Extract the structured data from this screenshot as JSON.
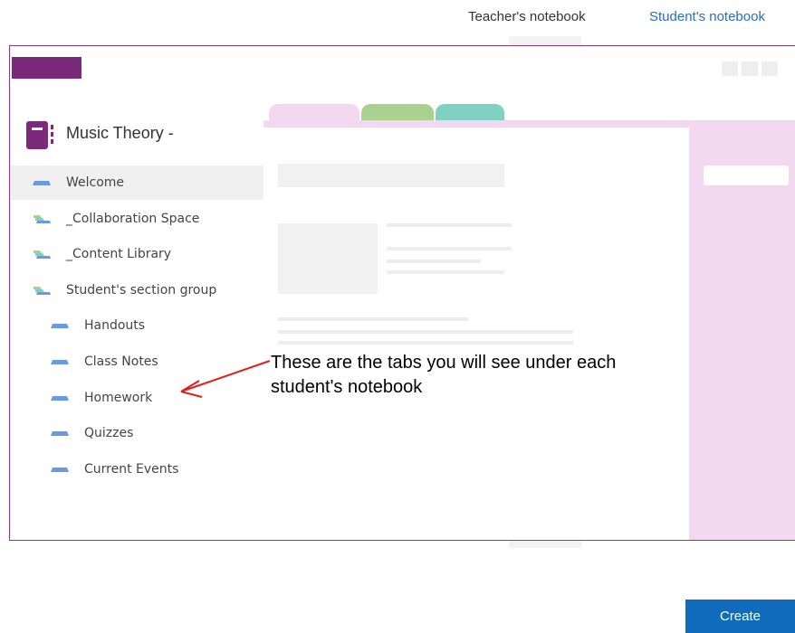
{
  "header": {
    "teacher_link": "Teacher's notebook",
    "student_link": "Student's notebook"
  },
  "notebook": {
    "title": "Music Theory -",
    "brand_color": "#7b2a7a"
  },
  "sections": [
    {
      "label": "Welcome",
      "type": "section",
      "selected": true
    },
    {
      "label": "_Collaboration Space",
      "type": "group"
    },
    {
      "label": "_Content Library",
      "type": "group"
    },
    {
      "label": "Student's section group",
      "type": "group"
    },
    {
      "label": "Handouts",
      "type": "section",
      "indent": 1
    },
    {
      "label": "Class Notes",
      "type": "section",
      "indent": 1
    },
    {
      "label": "Homework",
      "type": "section",
      "indent": 1
    },
    {
      "label": "Quizzes",
      "type": "section",
      "indent": 1
    },
    {
      "label": "Current Events",
      "type": "section",
      "indent": 1
    }
  ],
  "annotation": {
    "text": "These are the tabs you will see under each student's notebook",
    "arrow_color": "#e02020"
  },
  "actions": {
    "create_label": "Create"
  },
  "colors": {
    "tab_pink": "#f2d9ef",
    "tab_green": "#a9d08e",
    "tab_teal": "#7fd1c1",
    "section_icon": "#6a9be0",
    "link_blue": "#2a6fb6"
  }
}
